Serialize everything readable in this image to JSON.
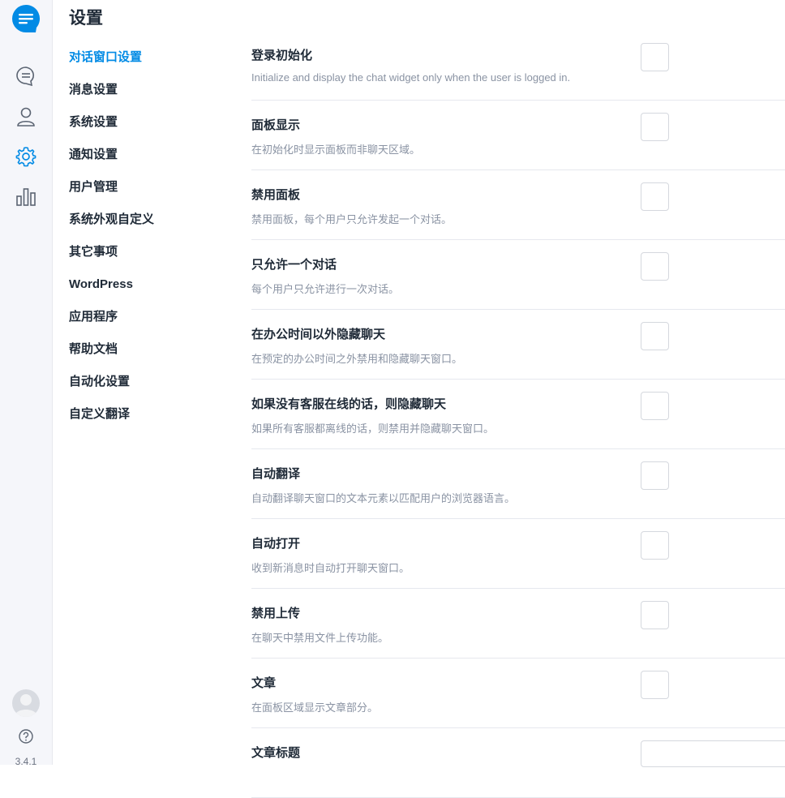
{
  "sidebar": {
    "icons": [
      "logo-chat-bubble",
      "conversations-icon",
      "user-icon",
      "gear-icon",
      "reports-bar-chart-icon"
    ],
    "active_icon": "gear-icon",
    "accent": "#028be5",
    "version": "3.4.1"
  },
  "page": {
    "title": "设置"
  },
  "nav": {
    "items": [
      {
        "label": "对话窗口设置"
      },
      {
        "label": "消息设置"
      },
      {
        "label": "系统设置"
      },
      {
        "label": "通知设置"
      },
      {
        "label": "用户管理"
      },
      {
        "label": "系统外观自定义"
      },
      {
        "label": "其它事项"
      },
      {
        "label": "WordPress"
      },
      {
        "label": "应用程序"
      },
      {
        "label": "帮助文档"
      },
      {
        "label": "自动化设置"
      },
      {
        "label": "自定义翻译"
      }
    ],
    "active_index": 0
  },
  "settings": {
    "rows": [
      {
        "title": "登录初始化",
        "description": "Initialize and display the chat widget only when the user is logged in.",
        "control": "checkbox"
      },
      {
        "title": "面板显示",
        "description": "在初始化时显示面板而非聊天区域。",
        "control": "checkbox"
      },
      {
        "title": "禁用面板",
        "description": "禁用面板，每个用户只允许发起一个对话。",
        "control": "checkbox"
      },
      {
        "title": "只允许一个对话",
        "description": "每个用户只允许进行一次对话。",
        "control": "checkbox"
      },
      {
        "title": "在办公时间以外隐藏聊天",
        "description": "在预定的办公时间之外禁用和隐藏聊天窗口。",
        "control": "checkbox"
      },
      {
        "title": "如果没有客服在线的话，则隐藏聊天",
        "description": "如果所有客服都离线的话，则禁用并隐藏聊天窗口。",
        "control": "checkbox"
      },
      {
        "title": "自动翻译",
        "description": "自动翻译聊天窗口的文本元素以匹配用户的浏览器语言。",
        "control": "checkbox"
      },
      {
        "title": "自动打开",
        "description": "收到新消息时自动打开聊天窗口。",
        "control": "checkbox"
      },
      {
        "title": "禁用上传",
        "description": "在聊天中禁用文件上传功能。",
        "control": "checkbox"
      },
      {
        "title": "文章",
        "description": "在面板区域显示文章部分。",
        "control": "checkbox"
      },
      {
        "title": "文章标题",
        "description": "",
        "control": "text",
        "value": ""
      }
    ]
  }
}
